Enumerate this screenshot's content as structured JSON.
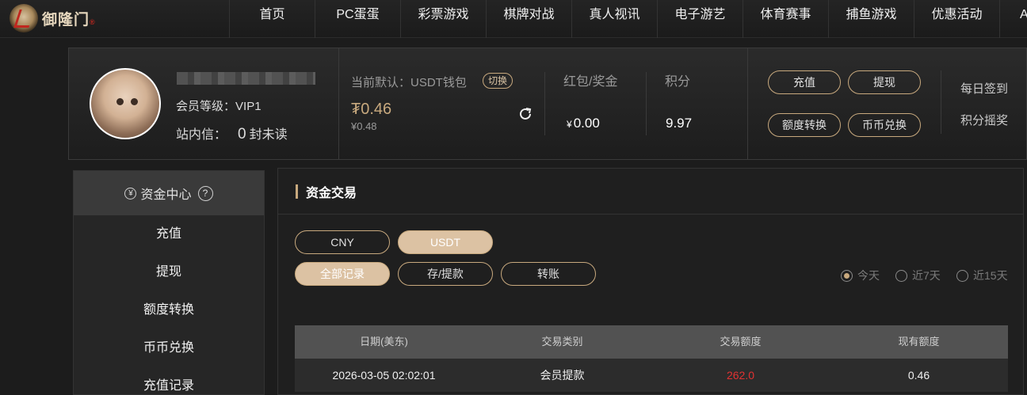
{
  "logo": {
    "name": "御隆门"
  },
  "nav": [
    "首页",
    "PC蛋蛋",
    "彩票游戏",
    "棋牌对战",
    "真人视讯",
    "电子游艺",
    "体育赛事",
    "捕鱼游戏",
    "优惠活动",
    "AI"
  ],
  "user": {
    "level_label": "会员等级：",
    "level": "VIP1",
    "msg_label": "站内信：",
    "msg_count": "0",
    "msg_unit": "封未读"
  },
  "wallet": {
    "default_label": "当前默认：USDT钱包",
    "switch_label": "切换",
    "balance": "₮0.46",
    "balance_cny": "¥0.48"
  },
  "bonus": {
    "label": "红包/奖金",
    "currency": "¥",
    "value": "0.00"
  },
  "points": {
    "label": "积分",
    "value": "9.97"
  },
  "actions": {
    "recharge": "充值",
    "withdraw": "提现",
    "transfer": "额度转换",
    "exchange": "币币兑换"
  },
  "right_links": {
    "checkin": "每日签到",
    "lottery": "积分摇奖"
  },
  "sidebar": {
    "title": "资金中心",
    "items": [
      "充值",
      "提现",
      "额度转换",
      "币币兑换",
      "充值记录"
    ]
  },
  "panel": {
    "title": "资金交易",
    "currencies": [
      "CNY",
      "USDT"
    ],
    "active_currency": "USDT",
    "filters": [
      "全部记录",
      "存/提款",
      "转账"
    ],
    "active_filter": "全部记录",
    "ranges": [
      "今天",
      "近7天",
      "近15天"
    ],
    "selected_range": "今天",
    "columns": [
      "日期(美东)",
      "交易类别",
      "交易额度",
      "现有额度"
    ],
    "rows": [
      {
        "date": "2026-03-05 02:02:01",
        "type": "会员提款",
        "amount": "262.0",
        "balance": "0.46"
      }
    ]
  }
}
